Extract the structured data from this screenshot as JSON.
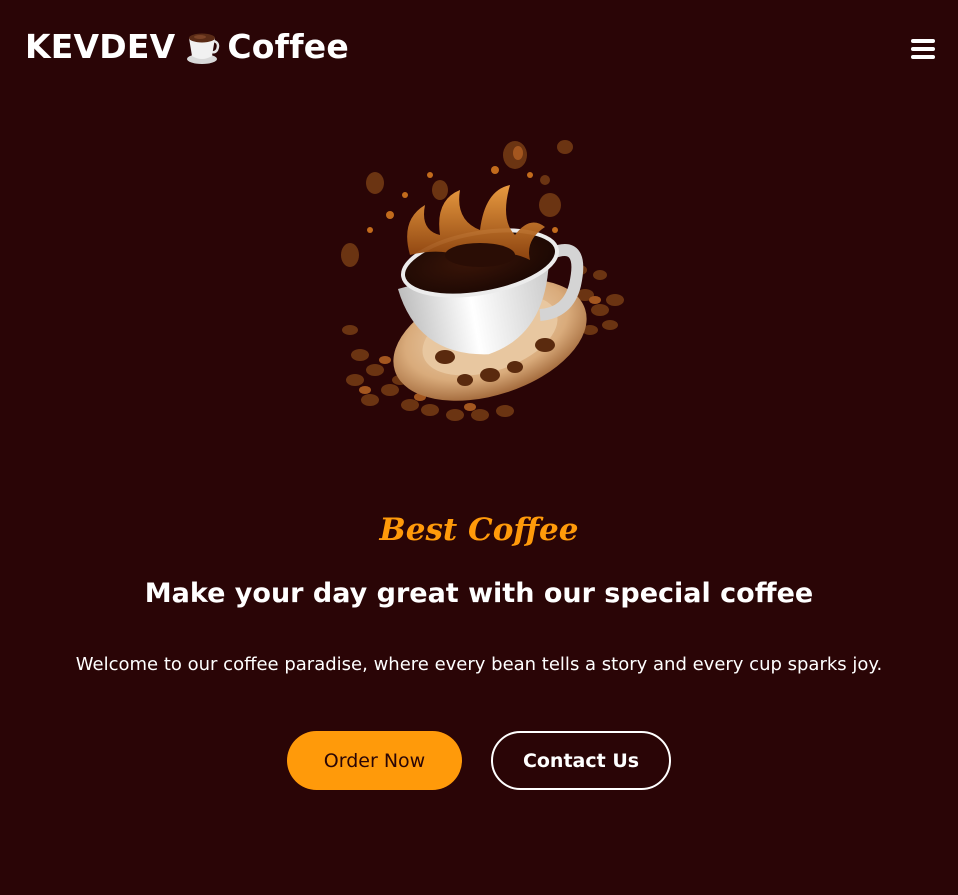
{
  "header": {
    "brand_left": "KEVDEV",
    "brand_right": "Coffee",
    "logo_icon": "coffee-cup-icon",
    "menu_icon": "hamburger-menu-icon"
  },
  "hero": {
    "image": "coffee-cup-splash-illustration",
    "tagline": "Best Coffee",
    "headline": "Make your day great with our special coffee",
    "description": "Welcome to our coffee paradise, where every bean tells a story and every cup sparks joy.",
    "primary_button": "Order Now",
    "secondary_button": "Contact Us"
  },
  "colors": {
    "background": "#2a0506",
    "accent": "#ff9a0a",
    "text": "#ffffff"
  }
}
